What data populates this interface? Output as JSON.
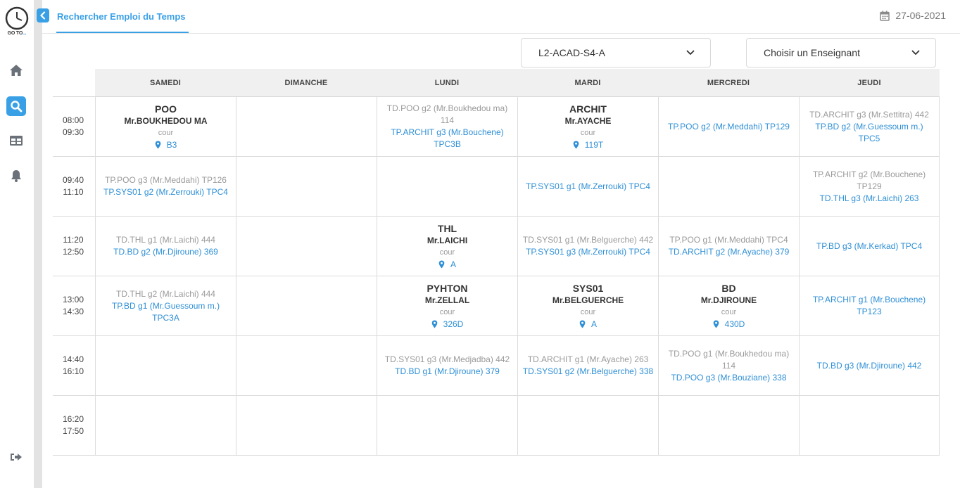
{
  "logo": {
    "text": "GO TO",
    "dots": "..."
  },
  "sidebar": {
    "icons": [
      "home-icon",
      "search-icon",
      "table-icon",
      "bell-icon",
      "logout-icon"
    ]
  },
  "header": {
    "tab_title": "Rechercher Emploi du Temps",
    "date": "27-06-2021"
  },
  "filters": {
    "group": "L2-ACAD-S4-A",
    "teacher": "Choisir un Enseignant"
  },
  "colors": {
    "accent": "#3aa0e6",
    "link": "#2e8fd6",
    "muted": "#9a9a9a"
  },
  "days": [
    "SAMEDI",
    "DIMANCHE",
    "LUNDI",
    "MARDI",
    "MERCREDI",
    "JEUDI"
  ],
  "times": [
    {
      "start": "08:00",
      "end": "09:30"
    },
    {
      "start": "09:40",
      "end": "11:10"
    },
    {
      "start": "11:20",
      "end": "12:50"
    },
    {
      "start": "13:00",
      "end": "14:30"
    },
    {
      "start": "14:40",
      "end": "16:10"
    },
    {
      "start": "16:20",
      "end": "17:50"
    }
  ],
  "schedule": [
    [
      {
        "kind": "course",
        "title": "POO",
        "teacher": "Mr.BOUKHEDOU MA",
        "type": "cour",
        "room": "B3"
      },
      null,
      {
        "kind": "list",
        "lines": [
          {
            "text": "TD.POO g2 (Mr.Boukhedou ma) 114",
            "style": "gray"
          },
          {
            "text": "TP.ARCHIT g3 (Mr.Bouchene) TPC3B",
            "style": "blue"
          }
        ]
      },
      {
        "kind": "course",
        "title": "ARCHIT",
        "teacher": "Mr.AYACHE",
        "type": "cour",
        "room": "119T"
      },
      {
        "kind": "list",
        "lines": [
          {
            "text": "TP.POO g2 (Mr.Meddahi) TP129",
            "style": "blue"
          }
        ]
      },
      {
        "kind": "list",
        "lines": [
          {
            "text": "TD.ARCHIT g3 (Mr.Settitra) 442",
            "style": "gray"
          },
          {
            "text": "TP.BD g2 (Mr.Guessoum m.) TPC5",
            "style": "blue"
          }
        ]
      }
    ],
    [
      {
        "kind": "list",
        "lines": [
          {
            "text": "TP.POO g3 (Mr.Meddahi) TP126",
            "style": "gray"
          },
          {
            "text": "TP.SYS01 g2 (Mr.Zerrouki) TPC4",
            "style": "blue"
          }
        ]
      },
      null,
      null,
      {
        "kind": "list",
        "lines": [
          {
            "text": "TP.SYS01 g1 (Mr.Zerrouki) TPC4",
            "style": "blue"
          }
        ]
      },
      null,
      {
        "kind": "list",
        "lines": [
          {
            "text": "TP.ARCHIT g2 (Mr.Bouchene) TP129",
            "style": "gray"
          },
          {
            "text": "TD.THL g3 (Mr.Laichi) 263",
            "style": "blue"
          }
        ]
      }
    ],
    [
      {
        "kind": "list",
        "lines": [
          {
            "text": "TD.THL g1 (Mr.Laichi) 444",
            "style": "gray"
          },
          {
            "text": "TD.BD g2 (Mr.Djiroune) 369",
            "style": "blue"
          }
        ]
      },
      null,
      {
        "kind": "course",
        "title": "THL",
        "teacher": "Mr.LAICHI",
        "type": "cour",
        "room": "A"
      },
      {
        "kind": "list",
        "lines": [
          {
            "text": "TD.SYS01 g1 (Mr.Belguerche) 442",
            "style": "gray"
          },
          {
            "text": "TP.SYS01 g3 (Mr.Zerrouki) TPC4",
            "style": "blue"
          }
        ]
      },
      {
        "kind": "list",
        "lines": [
          {
            "text": "TP.POO g1 (Mr.Meddahi) TPC4",
            "style": "gray"
          },
          {
            "text": "TD.ARCHIT g2 (Mr.Ayache) 379",
            "style": "blue"
          }
        ]
      },
      {
        "kind": "list",
        "lines": [
          {
            "text": "TP.BD g3 (Mr.Kerkad) TPC4",
            "style": "blue"
          }
        ]
      }
    ],
    [
      {
        "kind": "list",
        "lines": [
          {
            "text": "TD.THL g2 (Mr.Laichi) 444",
            "style": "gray"
          },
          {
            "text": "TP.BD g1 (Mr.Guessoum m.) TPC3A",
            "style": "blue"
          }
        ]
      },
      null,
      {
        "kind": "course",
        "title": "PYHTON",
        "teacher": "Mr.ZELLAL",
        "type": "cour",
        "room": "326D"
      },
      {
        "kind": "course",
        "title": "SYS01",
        "teacher": "Mr.BELGUERCHE",
        "type": "cour",
        "room": "A"
      },
      {
        "kind": "course",
        "title": "BD",
        "teacher": "Mr.DJIROUNE",
        "type": "cour",
        "room": "430D"
      },
      {
        "kind": "list",
        "lines": [
          {
            "text": "TP.ARCHIT g1 (Mr.Bouchene) TP123",
            "style": "blue"
          }
        ]
      }
    ],
    [
      null,
      null,
      {
        "kind": "list",
        "lines": [
          {
            "text": "TD.SYS01 g3 (Mr.Medjadba) 442",
            "style": "gray"
          },
          {
            "text": "TD.BD g1 (Mr.Djiroune) 379",
            "style": "blue"
          }
        ]
      },
      {
        "kind": "list",
        "lines": [
          {
            "text": "TD.ARCHIT g1 (Mr.Ayache) 263",
            "style": "gray"
          },
          {
            "text": "TD.SYS01 g2 (Mr.Belguerche) 338",
            "style": "blue"
          }
        ]
      },
      {
        "kind": "list",
        "lines": [
          {
            "text": "TD.POO g1 (Mr.Boukhedou ma) 114",
            "style": "gray"
          },
          {
            "text": "TD.POO g3 (Mr.Bouziane) 338",
            "style": "blue"
          }
        ]
      },
      {
        "kind": "list",
        "lines": [
          {
            "text": "TD.BD g3 (Mr.Djiroune) 442",
            "style": "blue"
          }
        ]
      }
    ],
    [
      null,
      null,
      null,
      null,
      null,
      null
    ]
  ]
}
